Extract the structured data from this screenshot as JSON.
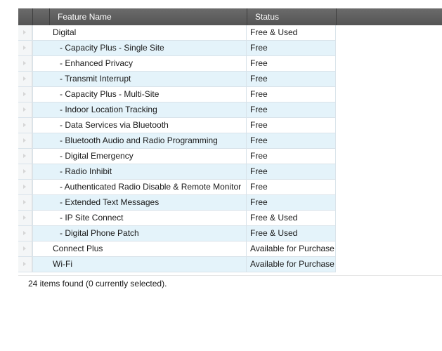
{
  "columns": {
    "feature_name": "Feature Name",
    "status": "Status"
  },
  "rows": [
    {
      "name": "Digital",
      "status": "Free & Used",
      "level": 0
    },
    {
      "name": "- Capacity Plus - Single Site",
      "status": "Free",
      "level": 1
    },
    {
      "name": "- Enhanced Privacy",
      "status": "Free",
      "level": 1
    },
    {
      "name": "- Transmit Interrupt",
      "status": "Free",
      "level": 1
    },
    {
      "name": "- Capacity Plus - Multi-Site",
      "status": "Free",
      "level": 1
    },
    {
      "name": "- Indoor Location Tracking",
      "status": "Free",
      "level": 1
    },
    {
      "name": "- Data Services via Bluetooth",
      "status": "Free",
      "level": 1
    },
    {
      "name": "- Bluetooth Audio and Radio Programming",
      "status": "Free",
      "level": 1
    },
    {
      "name": "- Digital Emergency",
      "status": "Free",
      "level": 1
    },
    {
      "name": "- Radio Inhibit",
      "status": "Free",
      "level": 1
    },
    {
      "name": "- Authenticated Radio Disable & Remote Monitor",
      "status": "Free",
      "level": 1
    },
    {
      "name": "- Extended Text Messages",
      "status": "Free",
      "level": 1
    },
    {
      "name": "- IP Site Connect",
      "status": "Free & Used",
      "level": 1
    },
    {
      "name": "- Digital Phone Patch",
      "status": "Free & Used",
      "level": 1
    },
    {
      "name": "Connect Plus",
      "status": "Available for Purchase",
      "level": 0
    },
    {
      "name": "Wi-Fi",
      "status": "Available for Purchase",
      "level": 0
    }
  ],
  "footer": {
    "summary": "24 items found (0 currently selected)."
  }
}
